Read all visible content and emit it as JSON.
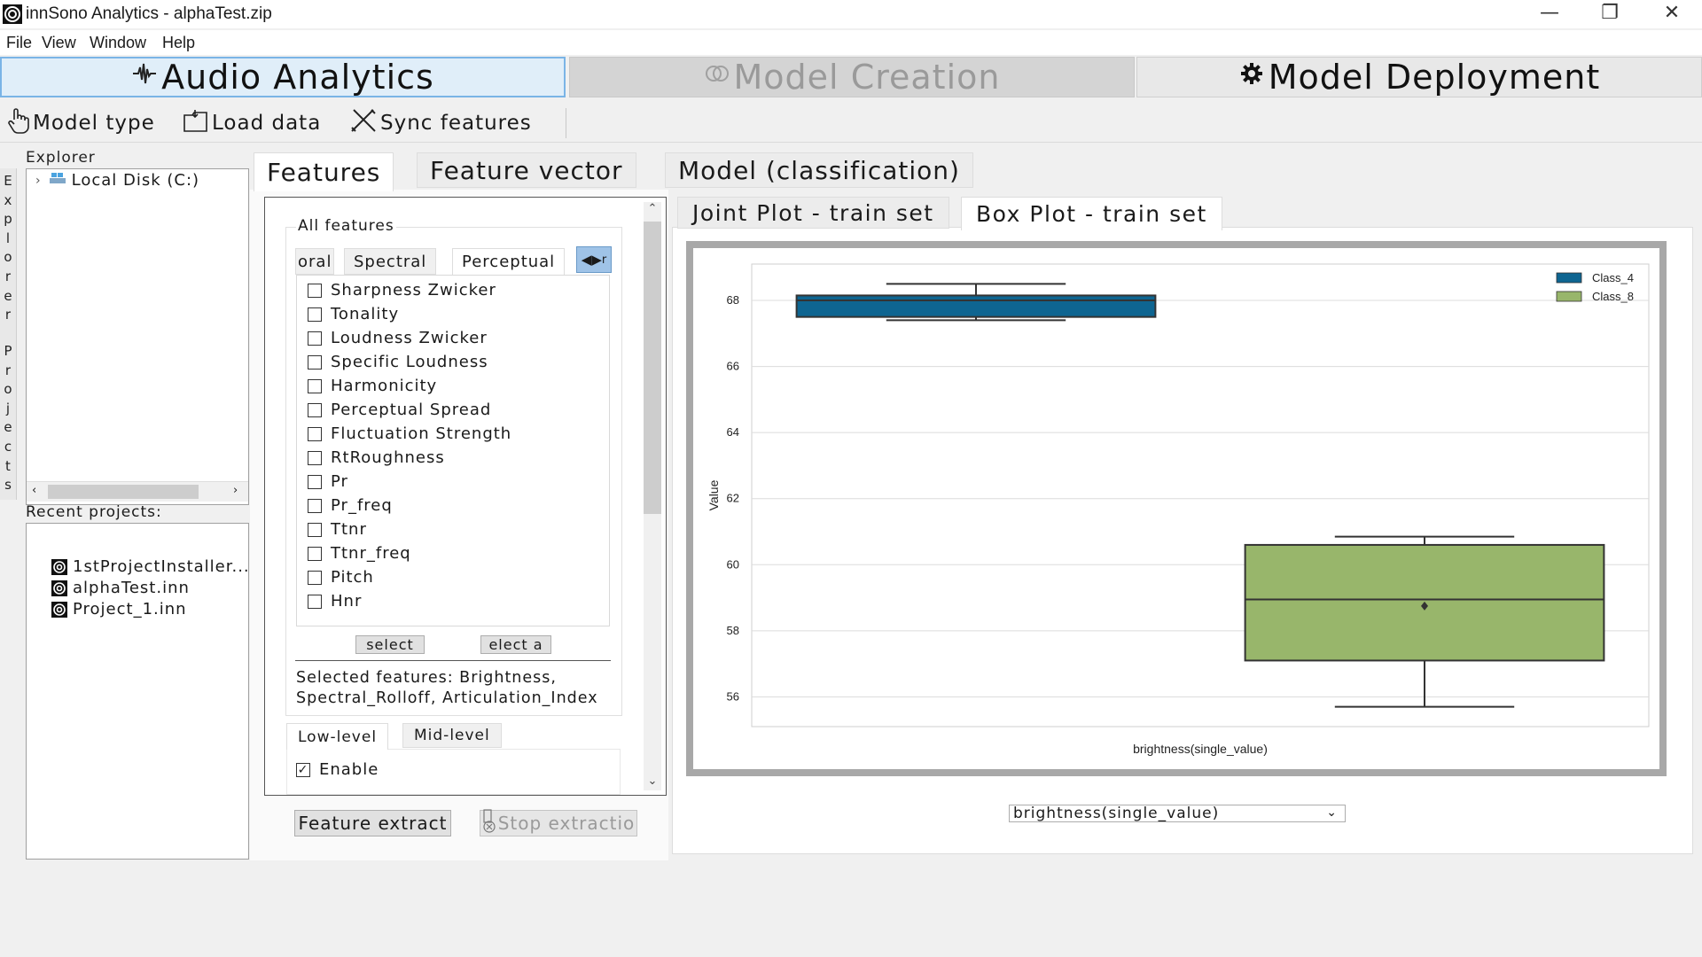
{
  "window": {
    "title": "innSono Analytics - alphaTest.zip",
    "controls": {
      "minimize": "—",
      "restore": "❐",
      "close": "✕"
    }
  },
  "menu": [
    "File",
    "View",
    "Window",
    "Help"
  ],
  "main_tabs": {
    "audio": {
      "label": "Audio Analytics",
      "icon": "waveform-icon"
    },
    "creation": {
      "label": "Model Creation",
      "icon": "brain-icon"
    },
    "deployment": {
      "label": "Model Deployment",
      "icon": "gear-icon"
    }
  },
  "toolbar": {
    "model_type": "Model type",
    "load_data": "Load data",
    "sync_features": "Sync features"
  },
  "side_strip": {
    "explorer": "Explorer",
    "projects": "Projects"
  },
  "explorer": {
    "label": "Explorer",
    "tree_item": "Local Disk (C:)"
  },
  "recent": {
    "label": "Recent projects:",
    "items": [
      "1stProjectInstaller...",
      "alphaTest.inn",
      "Project_1.inn"
    ]
  },
  "sub_tabs": {
    "features": "Features",
    "feature_vector": "Feature vector",
    "model": "Model (classification)"
  },
  "features_panel": {
    "group_label": "All features",
    "category_tabs": [
      "oral",
      "Spectral",
      "Perceptual"
    ],
    "arrow_overflow": "r",
    "items": [
      "Sharpness Zwicker",
      "Tonality",
      "Loudness Zwicker",
      "Specific Loudness",
      "Harmonicity",
      "Perceptual Spread",
      "Fluctuation Strength",
      "RtRoughness",
      "Pr",
      "Pr_freq",
      "Ttnr",
      "Ttnr_freq",
      "Pitch",
      "Hnr"
    ],
    "select_btn": "select",
    "deselect_btn": "elect a",
    "selected_text": "Selected features: Brightness, Spectral_Rolloff, Articulation_Index",
    "level_tabs": {
      "low": "Low-level",
      "mid": "Mid-level"
    },
    "enable_label": "Enable",
    "enable_checked": true
  },
  "buttons": {
    "extract": "Feature extract",
    "stop": "Stop extractio"
  },
  "plot_tabs": {
    "joint": "Joint Plot - train set",
    "box": "Box Plot - train set"
  },
  "feature_select": {
    "value": "brightness(single_value)"
  },
  "chart_data": {
    "type": "box",
    "xlabel": "brightness(single_value)",
    "ylabel": "Value",
    "yticks": [
      56,
      58,
      60,
      62,
      64,
      66,
      68
    ],
    "ylim": [
      55.1,
      69.1
    ],
    "grid": true,
    "legend_position": "top-right",
    "series": [
      {
        "name": "Class_4",
        "color": "#0e6591",
        "min": 67.4,
        "q1": 67.5,
        "median": 68.0,
        "q3": 68.15,
        "max": 68.5,
        "outliers": []
      },
      {
        "name": "Class_8",
        "color": "#98b66b",
        "min": 55.7,
        "q1": 57.1,
        "median": 58.95,
        "q3": 60.6,
        "max": 60.85,
        "outliers": [
          58.75
        ]
      }
    ]
  }
}
